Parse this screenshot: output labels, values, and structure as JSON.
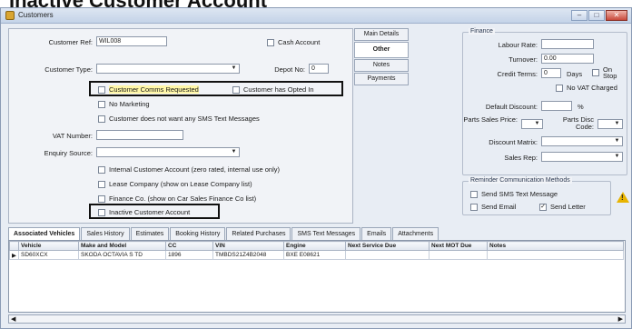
{
  "heading": "Inactive Customer Account",
  "window": {
    "title": "Customers"
  },
  "left": {
    "customer_ref_label": "Customer Ref:",
    "customer_ref_value": "WIL008",
    "cash_account_label": "Cash Account",
    "customer_type_label": "Customer Type:",
    "depot_no_label": "Depot No:",
    "depot_no_value": "0",
    "comms_requested_label": "Customer Comms Requested",
    "opted_in_label": "Customer has Opted In",
    "no_marketing_label": "No Marketing",
    "no_sms_label": "Customer does not want any SMS Text Messages",
    "vat_number_label": "VAT Number:",
    "enquiry_source_label": "Enquiry Source:",
    "internal_account_label": "Internal Customer Account (zero rated, internal use only)",
    "lease_company_label": "Lease Company (show on Lease Company list)",
    "finance_co_label": "Finance Co. (show on Car Sales Finance Co list)",
    "inactive_label": "Inactive Customer Account"
  },
  "side_tabs": [
    "Main Details",
    "Other",
    "Notes",
    "Payments"
  ],
  "finance": {
    "group_title": "Finance",
    "labour_rate_label": "Labour Rate:",
    "turnover_label": "Turnover:",
    "turnover_value": "0.00",
    "credit_terms_label": "Credit Terms:",
    "credit_terms_value": "0",
    "days_label": "Days",
    "on_stop_label": "On Stop",
    "no_vat_label": "No VAT Charged",
    "default_discount_label": "Default Discount:",
    "percent": "%",
    "parts_sales_price_label": "Parts Sales Price:",
    "parts_disc_code_label": "Parts Disc Code:",
    "discount_matrix_label": "Discount Matrix:",
    "sales_rep_label": "Sales Rep:"
  },
  "reminder": {
    "group_title": "Reminder Communication Methods",
    "send_sms_label": "Send SMS Text Message",
    "send_email_label": "Send Email",
    "send_letter_label": "Send Letter"
  },
  "bottom_tabs": [
    "Associated Vehicles",
    "Sales History",
    "Estimates",
    "Booking History",
    "Related Purchases",
    "SMS Text Messages",
    "Emails",
    "Attachments"
  ],
  "vehicles": {
    "columns": [
      "Vehicle",
      "Make and Model",
      "CC",
      "VIN",
      "Engine",
      "Next Service Due",
      "Next MOT Due",
      "Notes"
    ],
    "rows": [
      {
        "marker": "▶",
        "cells": [
          "SD60XCX",
          "SKODA OCTAVIA S TD",
          "1896",
          "TMBDS21Z4B2048",
          "BXE E08621",
          "",
          "",
          ""
        ]
      }
    ]
  },
  "colors": {
    "highlight": "#fff7a8",
    "warning": "#e8b400"
  }
}
